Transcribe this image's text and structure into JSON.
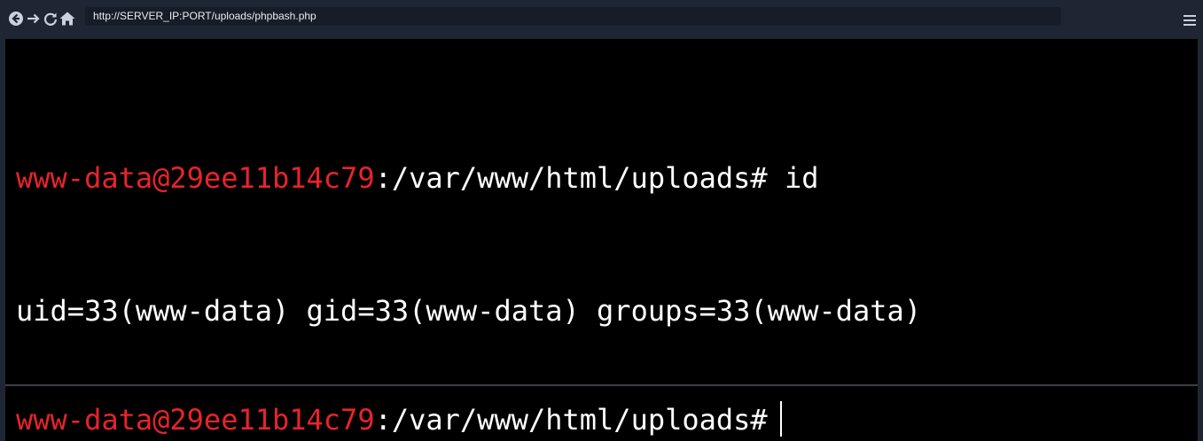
{
  "browser": {
    "url": "http://SERVER_IP:PORT/uploads/phpbash.php",
    "icons": {
      "back": "back-circle-icon",
      "forward": "forward-arrow-icon",
      "reload": "reload-icon",
      "home": "home-icon",
      "menu": "hamburger-menu-icon"
    },
    "toolbar_color": "#1f2633"
  },
  "terminal": {
    "history": [
      {
        "user_host": "www-data@29ee11b14c79",
        "path_and_command": ":/var/www/html/uploads# id"
      }
    ],
    "output": [
      "uid=33(www-data) gid=33(www-data) groups=33(www-data)"
    ],
    "current_prompt": {
      "user_host": "www-data@29ee11b14c79",
      "path": ":/var/www/html/uploads#"
    },
    "colors": {
      "user_host": "#e8232b",
      "text": "#ffffff",
      "background": "#000000"
    }
  }
}
